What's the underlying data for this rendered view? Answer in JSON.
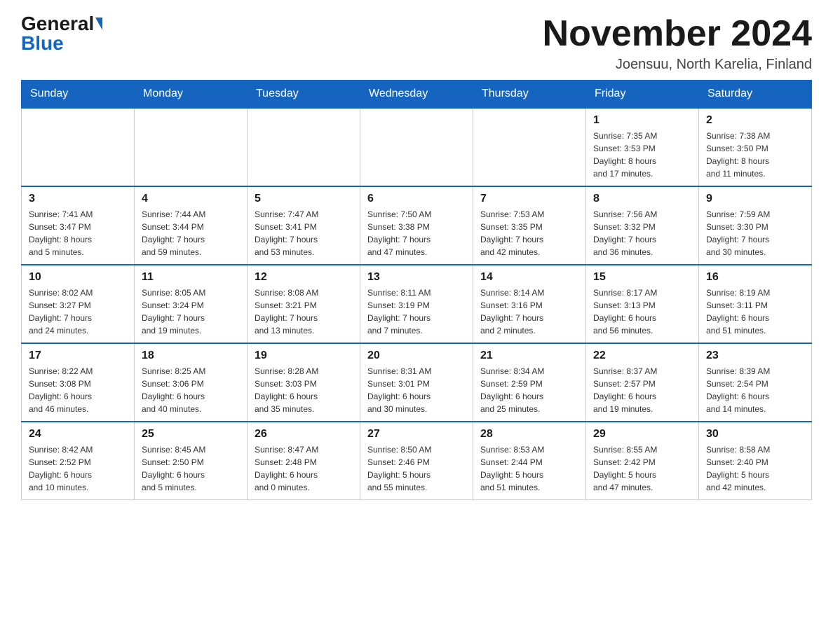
{
  "header": {
    "logo_general": "General",
    "logo_blue": "Blue",
    "month_title": "November 2024",
    "location": "Joensuu, North Karelia, Finland"
  },
  "days_of_week": [
    "Sunday",
    "Monday",
    "Tuesday",
    "Wednesday",
    "Thursday",
    "Friday",
    "Saturday"
  ],
  "weeks": [
    [
      {
        "day": "",
        "info": ""
      },
      {
        "day": "",
        "info": ""
      },
      {
        "day": "",
        "info": ""
      },
      {
        "day": "",
        "info": ""
      },
      {
        "day": "",
        "info": ""
      },
      {
        "day": "1",
        "info": "Sunrise: 7:35 AM\nSunset: 3:53 PM\nDaylight: 8 hours\nand 17 minutes."
      },
      {
        "day": "2",
        "info": "Sunrise: 7:38 AM\nSunset: 3:50 PM\nDaylight: 8 hours\nand 11 minutes."
      }
    ],
    [
      {
        "day": "3",
        "info": "Sunrise: 7:41 AM\nSunset: 3:47 PM\nDaylight: 8 hours\nand 5 minutes."
      },
      {
        "day": "4",
        "info": "Sunrise: 7:44 AM\nSunset: 3:44 PM\nDaylight: 7 hours\nand 59 minutes."
      },
      {
        "day": "5",
        "info": "Sunrise: 7:47 AM\nSunset: 3:41 PM\nDaylight: 7 hours\nand 53 minutes."
      },
      {
        "day": "6",
        "info": "Sunrise: 7:50 AM\nSunset: 3:38 PM\nDaylight: 7 hours\nand 47 minutes."
      },
      {
        "day": "7",
        "info": "Sunrise: 7:53 AM\nSunset: 3:35 PM\nDaylight: 7 hours\nand 42 minutes."
      },
      {
        "day": "8",
        "info": "Sunrise: 7:56 AM\nSunset: 3:32 PM\nDaylight: 7 hours\nand 36 minutes."
      },
      {
        "day": "9",
        "info": "Sunrise: 7:59 AM\nSunset: 3:30 PM\nDaylight: 7 hours\nand 30 minutes."
      }
    ],
    [
      {
        "day": "10",
        "info": "Sunrise: 8:02 AM\nSunset: 3:27 PM\nDaylight: 7 hours\nand 24 minutes."
      },
      {
        "day": "11",
        "info": "Sunrise: 8:05 AM\nSunset: 3:24 PM\nDaylight: 7 hours\nand 19 minutes."
      },
      {
        "day": "12",
        "info": "Sunrise: 8:08 AM\nSunset: 3:21 PM\nDaylight: 7 hours\nand 13 minutes."
      },
      {
        "day": "13",
        "info": "Sunrise: 8:11 AM\nSunset: 3:19 PM\nDaylight: 7 hours\nand 7 minutes."
      },
      {
        "day": "14",
        "info": "Sunrise: 8:14 AM\nSunset: 3:16 PM\nDaylight: 7 hours\nand 2 minutes."
      },
      {
        "day": "15",
        "info": "Sunrise: 8:17 AM\nSunset: 3:13 PM\nDaylight: 6 hours\nand 56 minutes."
      },
      {
        "day": "16",
        "info": "Sunrise: 8:19 AM\nSunset: 3:11 PM\nDaylight: 6 hours\nand 51 minutes."
      }
    ],
    [
      {
        "day": "17",
        "info": "Sunrise: 8:22 AM\nSunset: 3:08 PM\nDaylight: 6 hours\nand 46 minutes."
      },
      {
        "day": "18",
        "info": "Sunrise: 8:25 AM\nSunset: 3:06 PM\nDaylight: 6 hours\nand 40 minutes."
      },
      {
        "day": "19",
        "info": "Sunrise: 8:28 AM\nSunset: 3:03 PM\nDaylight: 6 hours\nand 35 minutes."
      },
      {
        "day": "20",
        "info": "Sunrise: 8:31 AM\nSunset: 3:01 PM\nDaylight: 6 hours\nand 30 minutes."
      },
      {
        "day": "21",
        "info": "Sunrise: 8:34 AM\nSunset: 2:59 PM\nDaylight: 6 hours\nand 25 minutes."
      },
      {
        "day": "22",
        "info": "Sunrise: 8:37 AM\nSunset: 2:57 PM\nDaylight: 6 hours\nand 19 minutes."
      },
      {
        "day": "23",
        "info": "Sunrise: 8:39 AM\nSunset: 2:54 PM\nDaylight: 6 hours\nand 14 minutes."
      }
    ],
    [
      {
        "day": "24",
        "info": "Sunrise: 8:42 AM\nSunset: 2:52 PM\nDaylight: 6 hours\nand 10 minutes."
      },
      {
        "day": "25",
        "info": "Sunrise: 8:45 AM\nSunset: 2:50 PM\nDaylight: 6 hours\nand 5 minutes."
      },
      {
        "day": "26",
        "info": "Sunrise: 8:47 AM\nSunset: 2:48 PM\nDaylight: 6 hours\nand 0 minutes."
      },
      {
        "day": "27",
        "info": "Sunrise: 8:50 AM\nSunset: 2:46 PM\nDaylight: 5 hours\nand 55 minutes."
      },
      {
        "day": "28",
        "info": "Sunrise: 8:53 AM\nSunset: 2:44 PM\nDaylight: 5 hours\nand 51 minutes."
      },
      {
        "day": "29",
        "info": "Sunrise: 8:55 AM\nSunset: 2:42 PM\nDaylight: 5 hours\nand 47 minutes."
      },
      {
        "day": "30",
        "info": "Sunrise: 8:58 AM\nSunset: 2:40 PM\nDaylight: 5 hours\nand 42 minutes."
      }
    ]
  ]
}
